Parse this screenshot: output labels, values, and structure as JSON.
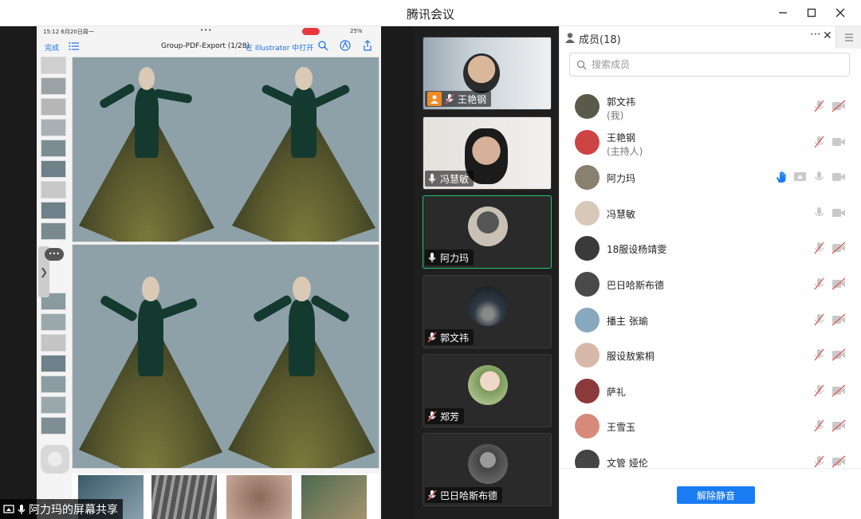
{
  "window": {
    "title": "腾讯会议"
  },
  "share": {
    "status_time": "15:12  6月20日周一",
    "status_dots": "•••",
    "battery": "25%",
    "done_label": "完成",
    "doc_title": "Group-PDF-Export (1/28)",
    "open_in": "在 Illustrator 中打开",
    "chat_dots": "•••",
    "sharer_label": "阿力玛的屏幕共享"
  },
  "videos": [
    {
      "name": "王艳钢",
      "host": true
    },
    {
      "name": "冯慧敏"
    },
    {
      "name": "阿力玛",
      "active": true
    },
    {
      "name": "郭文祎"
    },
    {
      "name": "郑芳"
    },
    {
      "name": "巴日哈斯布德"
    }
  ],
  "panel": {
    "title": "成员(18)",
    "search_placeholder": "搜索成员",
    "unmute_label": "解除静音",
    "members": [
      {
        "name": "郭文祎",
        "sub": "(我)",
        "mic": "muted",
        "cam": "off"
      },
      {
        "name": "王艳钢",
        "sub": "(主持人)",
        "mic": "muted",
        "cam": "on"
      },
      {
        "name": "阿力玛",
        "sub": "",
        "mic": "on",
        "cam": "on",
        "hand": true,
        "sharing": true
      },
      {
        "name": "冯慧敏",
        "sub": "",
        "mic": "on",
        "cam": "on"
      },
      {
        "name": "18服设杨靖雯",
        "sub": "",
        "mic": "muted",
        "cam": "off"
      },
      {
        "name": "巴日哈斯布德",
        "sub": "",
        "mic": "muted",
        "cam": "off"
      },
      {
        "name": "播主 张瑜",
        "sub": "",
        "mic": "muted",
        "cam": "off"
      },
      {
        "name": "服设敖紫桐",
        "sub": "",
        "mic": "muted",
        "cam": "off"
      },
      {
        "name": "萨礼",
        "sub": "",
        "mic": "muted",
        "cam": "off"
      },
      {
        "name": "王雪玉",
        "sub": "",
        "mic": "muted",
        "cam": "off"
      },
      {
        "name": "文管 娅伦",
        "sub": "",
        "mic": "muted",
        "cam": "off"
      }
    ]
  },
  "colors": {
    "accent": "#1a7cf2",
    "active_border": "#27c277",
    "host_badge": "#f08a24",
    "muted_red": "#e05a5a"
  }
}
